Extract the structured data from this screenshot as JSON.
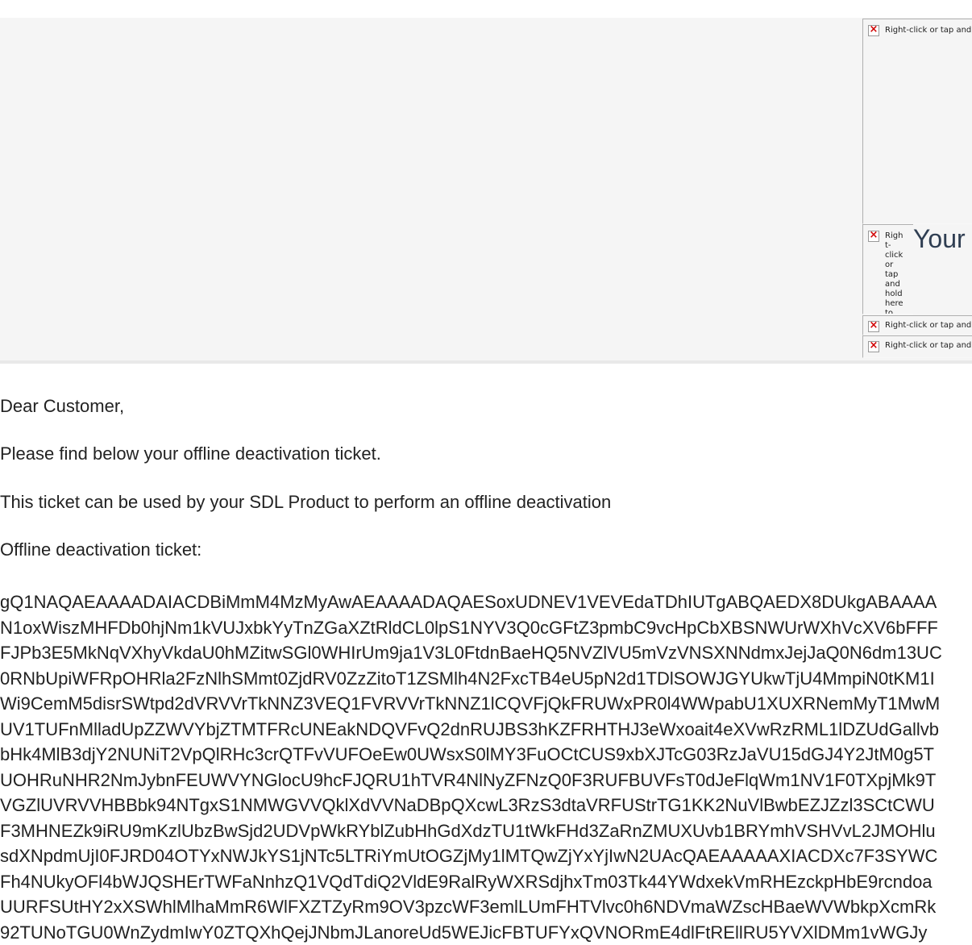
{
  "header": {
    "title": "Your",
    "broken_image_alt_1": "Right-click or tap and hold here to download pictures.",
    "broken_image_alt_2": "Right-click or tap and hold here to...",
    "broken_image_alt_3": "Right-click or tap and hold here to download pictures.",
    "broken_image_alt_4": "Right-click or tap and hold here to download pictures."
  },
  "body": {
    "greeting": "Dear Customer,",
    "line1": "Please find below your offline deactivation ticket.",
    "line2": "This ticket can be used by your SDL Product to perform an offline deactivation",
    "ticket_label": "Offline deactivation ticket:",
    "ticket_lines": [
      "gQ1NAQAEAAAADAIACDBiMmM4MzMyAwAEAAAADAQAESoxUDNEV1VEVEdaTDhIUTgABQAEDX8DUkgABAAAA",
      "N1oxWiszMHFDb0hjNm1kVUJxbkYyTnZGaXZtRldCL0lpS1NYV3Q0cGFtZ3pmbC9vcHpCbXBSNWUrWXhVcXV6bFFF",
      "FJPb3E5MkNqVXhyVkdaU0hMZitwSGl0WHIrUm9ja1V3L0FtdnBaeHQ5NVZlVU5mVzVNSXNNdmxJejJaQ0N6dm13UC",
      "0RNbUpiWFRpOHRla2FzNlhSMmt0ZjdRV0ZzZitoT1ZSMlh4N2FxcTB4eU5pN2d1TDlSOWJGYUkwTjU4MmpiN0tKM1I",
      "Wi9CemM5disrSWtpd2dVRVVrTkNNZ3VEQ1FVRVVrTkNNZ1lCQVFjQkFRUWxPR0l4WWpabU1XUXRNemMyT1MwM",
      "UV1TUFnMlladUpZZWVYbjZTMTFRcUNEakNDQVFvQ2dnRUJBS3hKZFRHTHJ3eWxoait4eXVwRzRML1lDZUdGallvb",
      "bHk4MlB3djY2NUNiT2VpQlRHc3crQTFvVUFOeEw0UWsxS0lMY3FuOCtCUS9xbXJTcG03RzJaVU15dGJ4Y2JtM0g5T",
      "UOHRuNHR2NmJybnFEUWVYNGlocU9hcFJQRU1hTVR4NlNyZFNzQ0F3RUFBUVFsT0dJeFlqWm1NV1F0TXpjMk9T",
      "VGZlUVRVVHBBbk94NTgxS1NMWGVVQklXdVVNaDBpQXcwL3RzS3dtaVRFUStrTG1KK2NuVlBwbEZJZzl3SCtCWU",
      "F3MHNEZk9iRU9mKzlUbzBwSjd2UDVpWkRYblZubHhGdXdzTU1tWkFHd3ZaRnZMUXUvb1BRYmhVSHVvL2JMOHlu",
      "sdXNpdmUjI0FJRD04OTYxNWJkYS1jNTc5LTRiYmUtOGZjMy1lMTQwZjYxYjIwN2UAcQAEAAAAAXIACDXc7F3SYWC",
      "Fh4NUkyOFl4bWJQSHErTWFaNnhzQ1VQdTdiQ2VldE9RalRyWXRSdjhxTm03Tk44YWdxekVmRHEzckpHbE9rcndoa",
      "UURFSUtHY2xXSWhlMlhaMmR6WlFXZTZyRm9OV3pzcWF3emlLUmFHTVlvc0h6NDVmaWZscHBaeWVWbkpXcmRk",
      "92TUNoTGU0WnZydmIwY0ZTQXhQejJNbmJLanoreUd5WEJicFBTUFYxQVNORmE4dlFtREllRU5YVXlDMm1vWGJy"
    ]
  }
}
